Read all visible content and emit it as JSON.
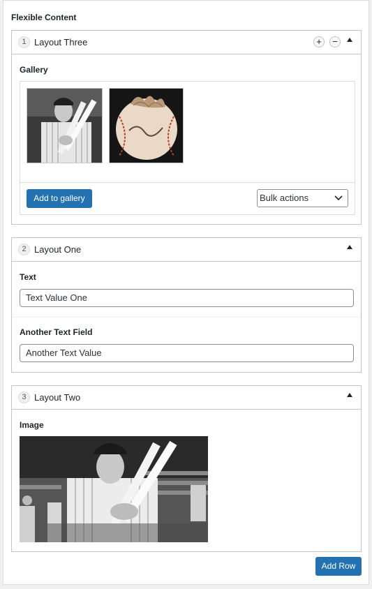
{
  "section_title": "Flexible Content",
  "layouts": [
    {
      "order": "1",
      "title": "Layout Three",
      "field_label": "Gallery",
      "add_to_gallery_label": "Add to gallery",
      "bulk_actions_label": "Bulk actions",
      "images": [
        "baseball-player-photo",
        "signed-baseball-photo"
      ]
    },
    {
      "order": "2",
      "title": "Layout One",
      "text_label": "Text",
      "text_value": "Text Value One",
      "another_label": "Another Text Field",
      "another_value": "Another Text Value"
    },
    {
      "order": "3",
      "title": "Layout Two",
      "field_label": "Image",
      "image": "baseball-player-photo"
    }
  ],
  "add_row_label": "Add Row",
  "colors": {
    "primary": "#2271b1",
    "border": "#c3c4c7"
  }
}
